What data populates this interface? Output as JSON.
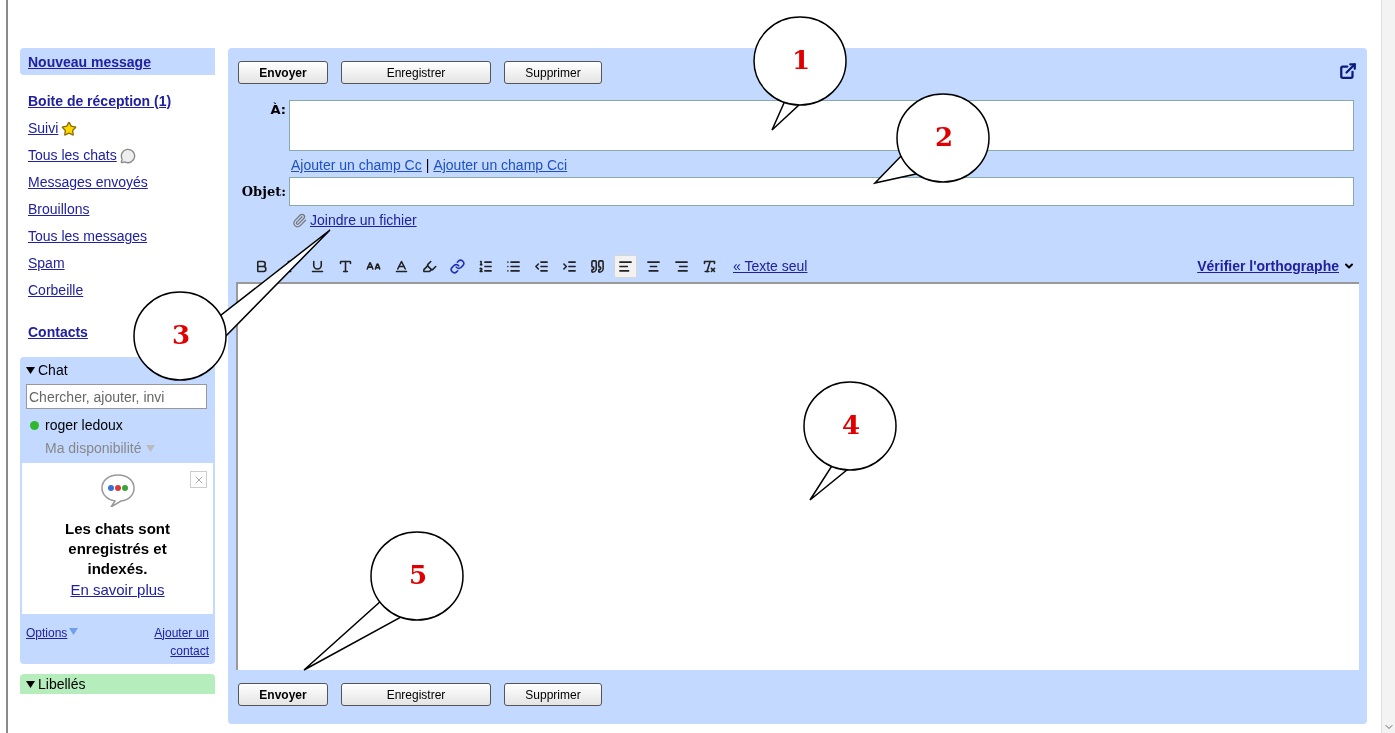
{
  "sidebar": {
    "compose": "Nouveau message",
    "items": [
      {
        "label": "Boite de réception (1)",
        "kind": "bold"
      },
      {
        "label": "Suivi",
        "kind": "star"
      },
      {
        "label": "Tous les chats",
        "kind": "chat"
      },
      {
        "label": "Messages envoyés",
        "kind": "link"
      },
      {
        "label": "Brouillons",
        "kind": "link"
      },
      {
        "label": "Tous les messages",
        "kind": "link"
      },
      {
        "label": "Spam",
        "kind": "link"
      },
      {
        "label": "Corbeille",
        "kind": "link"
      }
    ],
    "contacts": "Contacts",
    "chat": {
      "title": "Chat",
      "expanded": true,
      "search": {
        "placeholder": "Chercher, ajouter, invi"
      },
      "contact": {
        "name": "roger ledoux",
        "color": "#2fb82f",
        "status": "Ma disponibilité"
      },
      "promo": {
        "text": "Les chats sont enregistrés et indexés.",
        "link": "En savoir plus"
      },
      "options": "Options",
      "add_contact": "Ajouter un contact"
    },
    "labels": {
      "title": "Libellés",
      "expanded": true
    }
  },
  "compose": {
    "top_buttons": [
      {
        "label": "Envoyer",
        "kind": "primary"
      },
      {
        "label": "Enregistrer",
        "kind": "normal"
      },
      {
        "label": "Supprimer",
        "kind": "normal"
      }
    ],
    "to_label": "À:",
    "add_cc": "Ajouter un champ Cc",
    "separator": "|",
    "add_bcc": "Ajouter un champ Cci",
    "subject_label": "Objet:",
    "attach": "Joindre un fichier",
    "toolbar": [
      {
        "kind": "bold",
        "selected": false
      },
      {
        "kind": "italic",
        "selected": false
      },
      {
        "kind": "underline",
        "selected": false
      },
      {
        "kind": "font",
        "selected": false
      },
      {
        "kind": "size",
        "selected": false
      },
      {
        "kind": "color",
        "selected": false
      },
      {
        "kind": "highlight",
        "selected": false
      },
      {
        "kind": "link",
        "selected": false
      },
      {
        "kind": "numbered",
        "selected": false
      },
      {
        "kind": "bulleted",
        "selected": false
      },
      {
        "kind": "outdent",
        "selected": false
      },
      {
        "kind": "indent",
        "selected": false
      },
      {
        "kind": "quote",
        "selected": false
      },
      {
        "kind": "align-left",
        "selected": true
      },
      {
        "kind": "align-center",
        "selected": false
      },
      {
        "kind": "align-right",
        "selected": false
      },
      {
        "kind": "clear",
        "selected": false
      }
    ],
    "plain_text": "« Texte seul",
    "spellcheck": "Vérifier l'orthographe",
    "bottom_buttons": [
      {
        "label": "Envoyer",
        "kind": "primary"
      },
      {
        "label": "Enregistrer",
        "kind": "normal"
      },
      {
        "label": "Supprimer",
        "kind": "normal"
      }
    ]
  },
  "callouts": [
    {
      "label": "1"
    },
    {
      "label": "2"
    },
    {
      "label": "3"
    },
    {
      "label": "4"
    },
    {
      "label": "5"
    }
  ]
}
